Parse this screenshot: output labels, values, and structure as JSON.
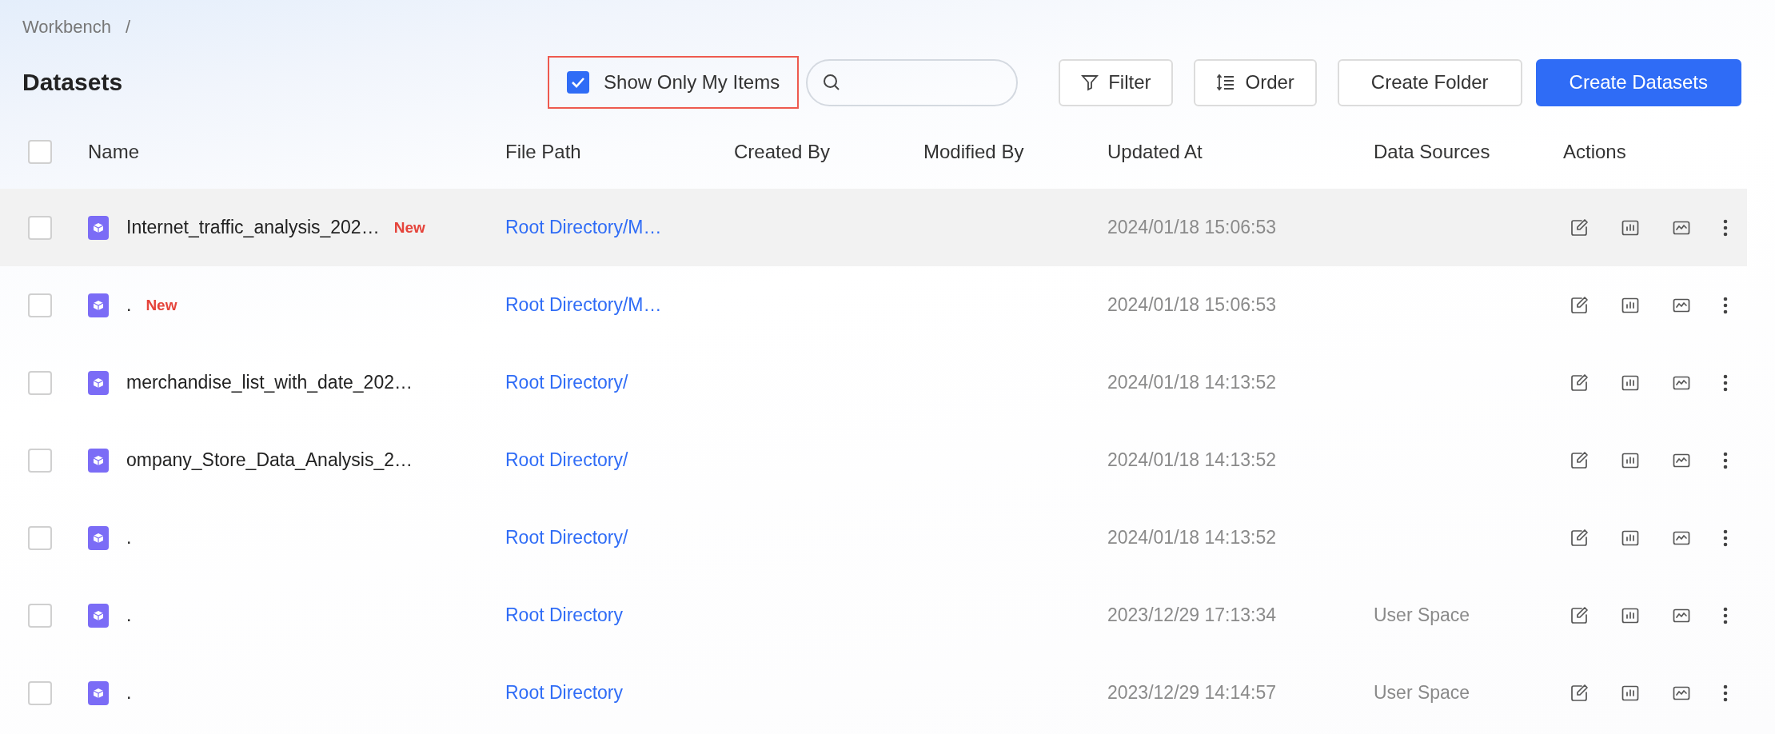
{
  "breadcrumb": {
    "items": [
      "Workbench"
    ],
    "separator": "/"
  },
  "title": "Datasets",
  "toolbar": {
    "show_only_my_items": {
      "label": "Show Only My Items",
      "checked": true,
      "outlined": true
    },
    "buttons": [
      {
        "label": "Filter",
        "kind": "filter"
      },
      {
        "label": "Order",
        "kind": "order"
      },
      {
        "label": "Create Folder",
        "kind": "plain"
      },
      {
        "label": "Create Datasets",
        "kind": "primary"
      }
    ]
  },
  "table": {
    "select_all": {
      "checked": false
    },
    "columns": [
      "Name",
      "File Path",
      "Created By",
      "Modified By",
      "Updated At",
      "Data Sources",
      "Actions"
    ],
    "rows": [
      {
        "checked": false,
        "highlighted": true,
        "name": "Internet_traffic_analysis_202…",
        "badge": "New",
        "file_path": "Root Directory/M…",
        "updated_at": "2024/01/18 15:06:53"
      },
      {
        "checked": false,
        "highlighted": false,
        "name": ".",
        "badge": "New",
        "file_path": "Root Directory/M…",
        "updated_at": "2024/01/18 15:06:53"
      },
      {
        "checked": false,
        "highlighted": false,
        "name": "merchandise_list_with_date_202…",
        "file_path": "Root Directory/",
        "updated_at": "2024/01/18 14:13:52"
      },
      {
        "checked": false,
        "highlighted": false,
        "name": "ompany_Store_Data_Analysis_2…",
        "file_path": "Root Directory/",
        "updated_at": "2024/01/18 14:13:52"
      },
      {
        "checked": false,
        "highlighted": false,
        "name": ".",
        "file_path": "Root Directory/",
        "updated_at": "2024/01/18 14:13:52"
      },
      {
        "checked": false,
        "highlighted": false,
        "name": ".",
        "file_path": "Root Directory",
        "updated_at": "2023/12/29 17:13:34",
        "data_sources": "User Space"
      },
      {
        "checked": false,
        "highlighted": false,
        "name": ".",
        "file_path": "Root Directory",
        "updated_at": "2023/12/29 14:14:57",
        "data_sources": "User Space"
      }
    ]
  }
}
